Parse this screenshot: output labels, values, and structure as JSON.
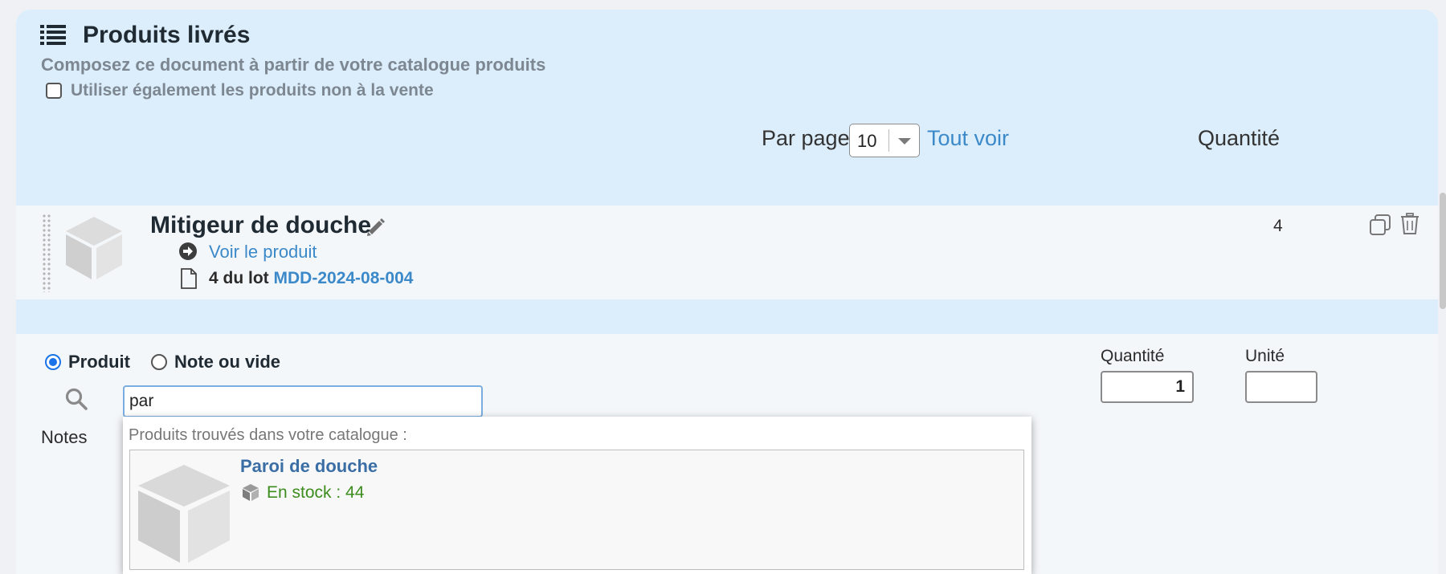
{
  "header": {
    "title": "Produits livrés",
    "subtitle": "Composez ce document à partir de votre catalogue produits",
    "checkbox_label": "Utiliser également les produits non à la vente",
    "per_page_label": "Par page",
    "per_page_value": "10",
    "see_all": "Tout voir",
    "quantity_header": "Quantité"
  },
  "product_row": {
    "name": "Mitigeur de douche",
    "view_link": "Voir le produit",
    "lot_prefix": "4 du lot",
    "lot_code": "MDD-2024-08-004",
    "quantity": "4"
  },
  "add_form": {
    "radio_product": "Produit",
    "radio_note": "Note ou vide",
    "search_value": "par",
    "notes_label": "Notes",
    "quantity_label": "Quantité",
    "quantity_value": "1",
    "unit_label": "Unité",
    "unit_value": ""
  },
  "dropdown": {
    "heading": "Produits trouvés dans votre catalogue :",
    "items": [
      {
        "name": "Paroi de douche",
        "stock": "En stock : 44"
      }
    ]
  },
  "colors": {
    "header_bg": "#dceefb",
    "link": "#3b89c9",
    "stock_green": "#3c8c1e",
    "result_name": "#3a6ea5"
  }
}
